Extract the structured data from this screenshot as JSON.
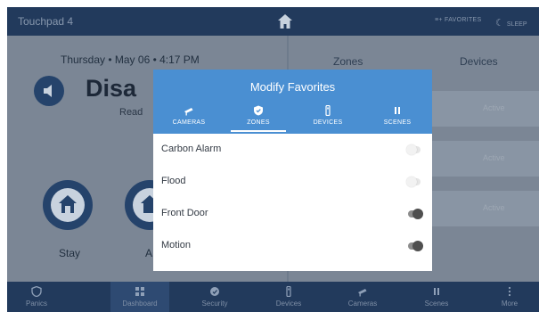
{
  "topbar": {
    "title": "Touchpad 4",
    "favorites_label": "FAVORITES",
    "sleep_label": "SLEEP"
  },
  "status_panel": {
    "date_line": "Thursday  •  May 06  •  4:17 PM",
    "status_text": "Disa",
    "status_sub": "Read",
    "arm_buttons": [
      {
        "label": "Stay"
      },
      {
        "label": "A"
      }
    ]
  },
  "right_panel": {
    "tabs": [
      {
        "label": "Zones"
      },
      {
        "label": "Devices"
      }
    ],
    "rows": [
      {
        "state": "Active"
      },
      {
        "state": "Active"
      },
      {
        "state": "Active"
      }
    ]
  },
  "modal": {
    "title": "Modify Favorites",
    "tabs": [
      {
        "label": "CAMERAS",
        "icon": "camera-icon"
      },
      {
        "label": "ZONES",
        "icon": "shield-icon",
        "active": true
      },
      {
        "label": "DEVICES",
        "icon": "device-icon"
      },
      {
        "label": "SCENES",
        "icon": "scenes-icon"
      }
    ],
    "items": [
      {
        "label": "Carbon Alarm",
        "enabled": false
      },
      {
        "label": "Flood",
        "enabled": false
      },
      {
        "label": "Front Door",
        "enabled": true
      },
      {
        "label": "Motion",
        "enabled": true
      }
    ]
  },
  "bottom_nav": [
    {
      "label": "Panics",
      "icon": "shield-icon"
    },
    {
      "label": "Dashboard",
      "icon": "dashboard-icon",
      "active": true
    },
    {
      "label": "Security",
      "icon": "security-icon"
    },
    {
      "label": "Devices",
      "icon": "device-icon"
    },
    {
      "label": "Cameras",
      "icon": "camera-icon"
    },
    {
      "label": "Scenes",
      "icon": "scenes-icon"
    },
    {
      "label": "More",
      "icon": "more-icon"
    }
  ],
  "colors": {
    "topbar": "#223a5c",
    "modal_header": "#4a8fd2",
    "overlay": "#7b8695"
  }
}
